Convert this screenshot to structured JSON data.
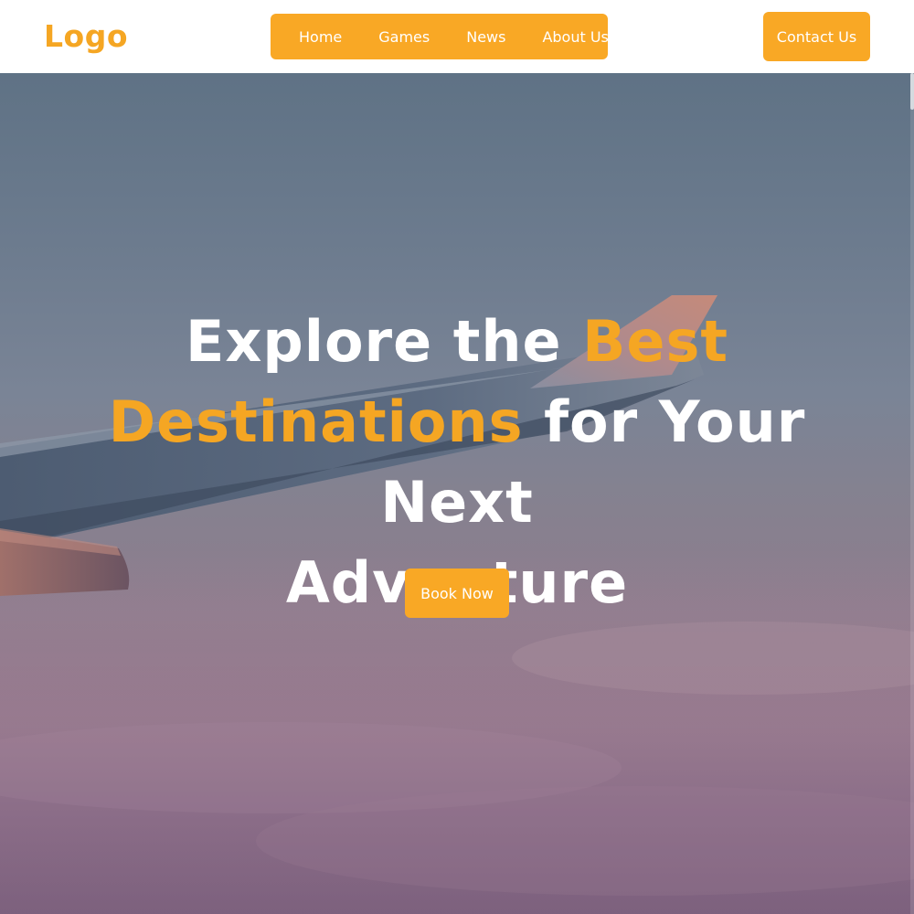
{
  "brand": {
    "logo_text": "Logo"
  },
  "nav": {
    "items": [
      {
        "label": "Home"
      },
      {
        "label": "Games"
      },
      {
        "label": "News"
      },
      {
        "label": "About Us"
      }
    ]
  },
  "header": {
    "contact_label": "Contact Us"
  },
  "hero": {
    "headline": {
      "part1": "Explore the ",
      "accent1": "Best",
      "accent2": "Destinations",
      "part2": " for Your Next",
      "part3": "Adventure"
    },
    "cta_label": "Book Now"
  },
  "colors": {
    "accent": "#f9a825",
    "accent_text": "#f5a623",
    "header_bg": "#ffffff",
    "headline_text": "#ffffff"
  },
  "icons": {
    "hero_image": "airplane-wing-sky-image"
  }
}
